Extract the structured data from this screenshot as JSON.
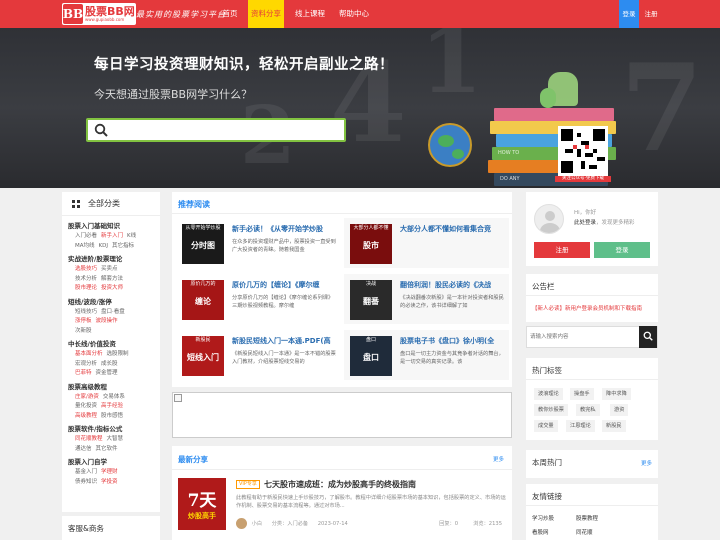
{
  "header": {
    "logo_mark": "BB",
    "logo_name": "股票BB网",
    "logo_url": "www.gupiaobb.com",
    "slogan": "最实用的股票学习平台",
    "nav": [
      "首页",
      "资料分享",
      "线上课程",
      "帮助中心"
    ],
    "login": "登录",
    "register": "注册",
    "colors": {
      "primary": "#e4393c",
      "nav_active_bg": "#ffd800",
      "login_bg": "#2d8cf0"
    }
  },
  "banner": {
    "headline": "每日学习投资理财知识，轻松开启副业之路！",
    "subline": "今天想通过股票BB网学习什么？",
    "search_placeholder": "",
    "qr_label": "关注公众号·免费下载",
    "book_spines": [
      "HOW TO",
      "DO ANY"
    ]
  },
  "categories": {
    "title": "全部分类",
    "groups": [
      {
        "title": "股票入门基础知识",
        "rows": [
          [
            "入门必看",
            "新手入门",
            "K线"
          ],
          [
            "MA均线",
            "KDJ",
            "其它指标"
          ]
        ]
      },
      {
        "title": "实战进阶/股票理论",
        "rows": [
          [
            "选股技巧",
            "买卖点"
          ],
          [
            "技术分析",
            "解套方法"
          ],
          [
            "股市理论",
            "投资大师"
          ]
        ]
      },
      {
        "title": "短线/波段/涨停",
        "rows": [
          [
            "短线技巧",
            "盘口·看盘"
          ],
          [
            "涨停板",
            "波段操作"
          ],
          [
            "次新股"
          ]
        ]
      },
      {
        "title": "中长线/价值投资",
        "rows": [
          [
            "基本面分析",
            "选股限制"
          ],
          [
            "宏观分析",
            "成长股"
          ],
          [
            "巴菲特",
            "资金管理"
          ]
        ]
      },
      {
        "title": "股票高级教程",
        "rows": [
          [
            "庄家/游资",
            "交易体系"
          ],
          [
            "量化投资",
            "高手经验"
          ],
          [
            "高级教程",
            "股市感悟"
          ]
        ]
      },
      {
        "title": "股票软件/指标公式",
        "rows": [
          [
            "同花顺教程",
            "大智慧"
          ],
          [
            "通达信",
            "其它软件"
          ]
        ]
      },
      {
        "title": "股票入门自学",
        "rows": [
          [
            "基金入门",
            "学理财"
          ],
          [
            "债券知识",
            "学投资"
          ]
        ]
      }
    ],
    "biz": "客服&商务"
  },
  "recommend": {
    "title": "推荐阅读",
    "cards": [
      {
        "thumb_top": "从零开始学炒股",
        "thumb_main": "分时图",
        "title": "新手必读！《从零开始学炒股",
        "desc": "在众多的投资理财产品中，股票投资一直受到广大投资者的青睐。随着我国金"
      },
      {
        "thumb_top": "大部分人都不懂",
        "thumb_main": "股市",
        "title": "大部分人都不懂如何看集合竞",
        "desc": ""
      },
      {
        "thumb_top": "原价几万的",
        "thumb_main": "缠论",
        "title": "原价几万的【缠论】《摩尔缠",
        "desc": "分享原价几万的【缠论】《摩尔缠论系列课》三期炒股视频教程。摩尔缠"
      },
      {
        "thumb_top": "决战",
        "thumb_main": "翻番",
        "title": "翻倍利润！股民必读的《决战",
        "desc": "《决战翻番次新股》是一本针对投资者和股民的必读之作，该书详细解了如"
      },
      {
        "thumb_top": "新股民",
        "thumb_main": "短线入门",
        "title": "新股民短线入门一本通.PDF(高",
        "desc": "《新股民短线入门一本通》是一本不错的股票入门教材，介绍股票短线交易的"
      },
      {
        "thumb_top": "盘口",
        "thumb_main": "盘口",
        "title": "股票电子书《盘口》徐小明(全",
        "desc": "盘口是一切主力资金与其竞争者对话的舞台，是一切交易的真实记录。该"
      }
    ]
  },
  "latest": {
    "title": "最新分享",
    "more": "更多",
    "item": {
      "vip": "VIP专享",
      "thumb_big": "7天",
      "thumb_sub": "炒股高手",
      "title": "七天股市速成班：成为炒股高手的终极指南",
      "desc": "此教程有助于新股民快速上手炒股技巧，了解股市。教程中详细介绍股票市场的基本知识，包括股票的定义、市场的运作机制、股票交易的基本流程等。通过对市场...",
      "author": "小白",
      "category": "分类：入门必备",
      "date": "2023-07-14",
      "replies": "回复：0",
      "views": "浏览：2135"
    }
  },
  "profile": {
    "hi": "Hi，你好",
    "hint_strong": "此处登录",
    "hint": "，发现更多精彩",
    "register": "注册",
    "login": "登录"
  },
  "notice": {
    "title": "公告栏",
    "text": "【新人必读】新用户登录会员机制和下载指南"
  },
  "side_search": {
    "placeholder": "请输入搜索内容"
  },
  "tags": {
    "title": "热门标签",
    "items": [
      "波浪理论",
      "操盘手",
      "降中求降",
      "教你炒股票",
      "教完私",
      "游资",
      "成交量",
      "江恩理论",
      "新股民"
    ]
  },
  "hot": {
    "title": "本周热门",
    "more": "更多"
  },
  "links": {
    "title": "友情链接",
    "items": [
      "学习炒股",
      "股票教程",
      "看股网",
      "同花顺"
    ]
  }
}
